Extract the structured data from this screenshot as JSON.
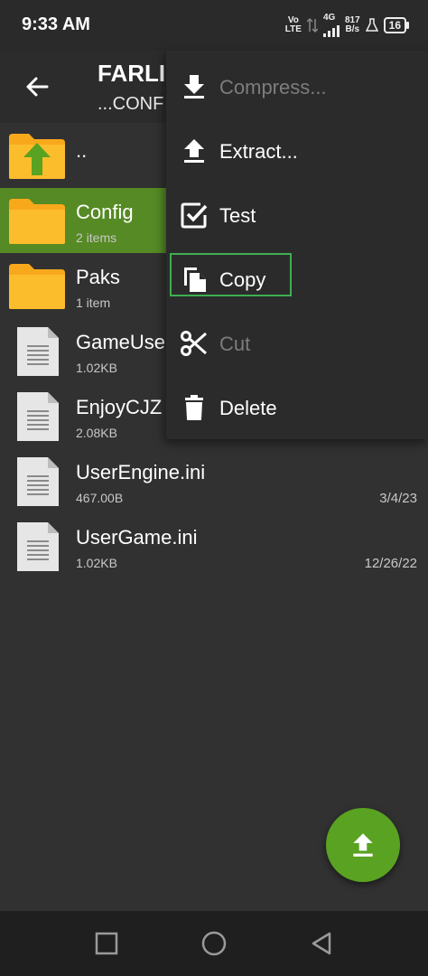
{
  "status": {
    "time": "9:33 AM",
    "volte_top": "Vo",
    "volte_bottom": "LTE",
    "network": "4G",
    "speed_value": "817",
    "speed_unit": "B/s",
    "battery": "16"
  },
  "appbar": {
    "title": "FARLI",
    "subtitle": "...CONF"
  },
  "files": [
    {
      "name": "..",
      "meta": "",
      "date": "",
      "type": "updir"
    },
    {
      "name": "Config",
      "meta": "2 items",
      "date": "",
      "type": "folder",
      "selected": true
    },
    {
      "name": "Paks",
      "meta": "1 item",
      "date": "",
      "type": "folder"
    },
    {
      "name": "GameUse",
      "meta": "1.02KB",
      "date": "",
      "type": "file"
    },
    {
      "name": "EnjoyCJZ",
      "meta": "2.08KB",
      "date": "",
      "type": "file"
    },
    {
      "name": "UserEngine.ini",
      "meta": "467.00B",
      "date": "3/4/23",
      "type": "file"
    },
    {
      "name": "UserGame.ini",
      "meta": "1.02KB",
      "date": "12/26/22",
      "type": "file"
    }
  ],
  "menu": [
    {
      "label": "Compress...",
      "icon": "download-icon",
      "enabled": false
    },
    {
      "label": "Extract...",
      "icon": "upload-icon",
      "enabled": true
    },
    {
      "label": "Test",
      "icon": "checkbox-icon",
      "enabled": true
    },
    {
      "label": "Copy",
      "icon": "copy-icon",
      "enabled": true,
      "highlighted": true
    },
    {
      "label": "Cut",
      "icon": "scissors-icon",
      "enabled": false
    },
    {
      "label": "Delete",
      "icon": "trash-icon",
      "enabled": true
    }
  ],
  "fab": {
    "icon": "upload-icon"
  },
  "navbar": {
    "icons": [
      "recents-square-icon",
      "home-circle-icon",
      "back-triangle-icon"
    ]
  },
  "colors": {
    "background": "#313131",
    "selected_row": "#568a25",
    "fab": "#5aa221",
    "folder": "#f8a91b",
    "highlight_border": "#3fae52"
  }
}
